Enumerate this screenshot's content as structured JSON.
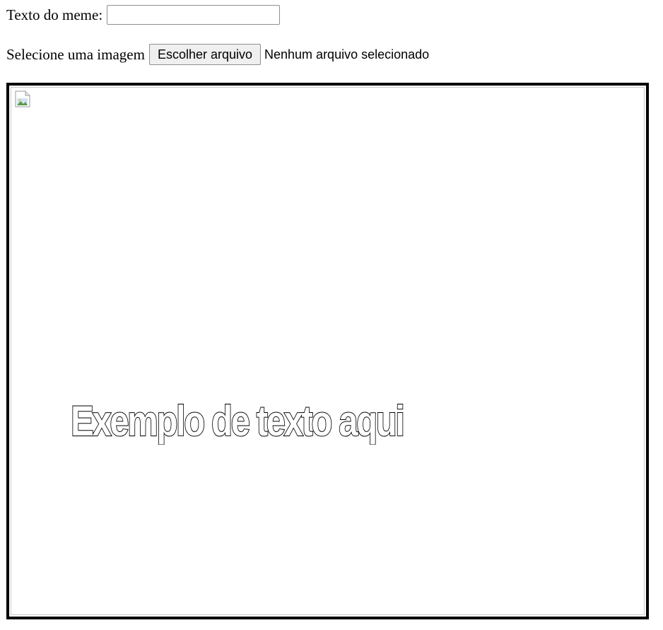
{
  "meme_text": {
    "label": "Texto do meme:",
    "value": "",
    "placeholder": ""
  },
  "image_select": {
    "label": "Selecione uma imagem",
    "button_label": "Escolher arquivo",
    "status": "Nenhum arquivo selecionado"
  },
  "preview": {
    "image_icon": "broken-image-icon",
    "caption": "Exemplo de texto aqui"
  },
  "colors": {
    "frame_border": "#000000",
    "caption_fill": "#ffffff",
    "caption_stroke": "#000000",
    "button_bg": "#efefef"
  }
}
